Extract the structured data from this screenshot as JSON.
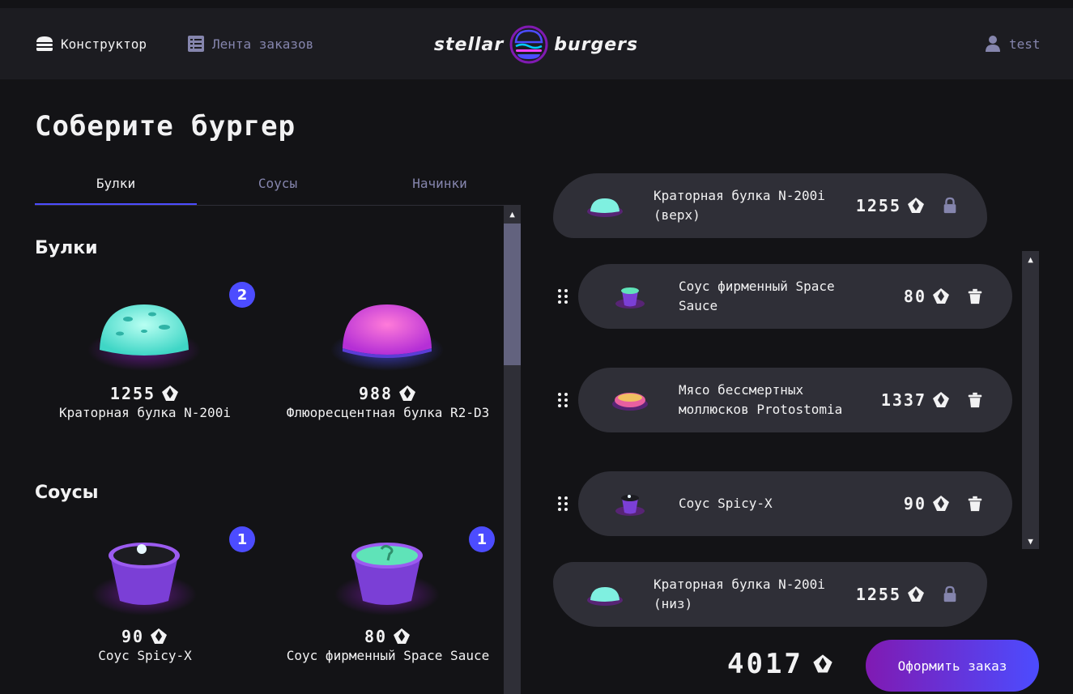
{
  "header": {
    "constructor_label": "Конструктор",
    "feed_label": "Лента заказов",
    "logo_left": "stellar",
    "logo_right": "burgers",
    "profile_label": "test"
  },
  "page_title": "Соберите бургер",
  "tabs": [
    {
      "label": "Булки",
      "active": true
    },
    {
      "label": "Соусы",
      "active": false
    },
    {
      "label": "Начинки",
      "active": false
    }
  ],
  "sections": {
    "buns": {
      "title": "Булки",
      "items": [
        {
          "name": "Краторная булка N-200i",
          "price": "1255",
          "count": "2",
          "icon": "crater-bun-image"
        },
        {
          "name": "Флюоресцентная булка R2-D3",
          "price": "988",
          "count": "",
          "icon": "fluorescent-bun-image"
        }
      ]
    },
    "sauces": {
      "title": "Соусы",
      "items": [
        {
          "name": "Соус Spicy-X",
          "price": "90",
          "count": "1",
          "icon": "spicy-sauce-image"
        },
        {
          "name": "Соус фирменный Space Sauce",
          "price": "80",
          "count": "1",
          "icon": "space-sauce-image"
        }
      ]
    }
  },
  "constructor": {
    "top_bun": {
      "name": "Краторная булка N-200i (верх)",
      "price": "1255"
    },
    "fillings": [
      {
        "name": "Соус фирменный Space Sauce",
        "price": "80"
      },
      {
        "name": "Мясо бессмертных моллюсков Protostomia",
        "price": "1337"
      },
      {
        "name": "Соус Spicy-X",
        "price": "90"
      }
    ],
    "bottom_bun": {
      "name": "Краторная булка N-200i (низ)",
      "price": "1255"
    }
  },
  "total": "4017",
  "order_button": "Оформить заказ",
  "colors": {
    "accent": "#4c4cff",
    "bg": "#131316",
    "panel": "#1c1c21",
    "item": "#2f2f37",
    "inactive": "#8585ad"
  }
}
